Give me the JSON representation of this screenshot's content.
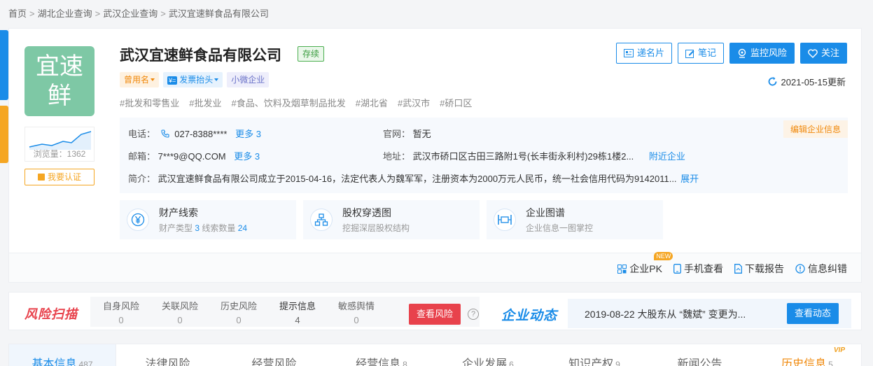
{
  "breadcrumb": [
    "首页",
    "湖北企业查询",
    "武汉企业查询",
    "武汉宜速鲜食品有限公司"
  ],
  "logo": {
    "line1": "宜速",
    "line2": "鲜",
    "bg_color": "#7ec8a5"
  },
  "views": {
    "label": "浏览量：1362"
  },
  "certify_label": "我要认证",
  "company": {
    "name": "武汉宜速鲜食品有限公司",
    "status": "存续"
  },
  "tags": {
    "former_name": "曾用名",
    "invoice": "发票抬头",
    "invoice_icon": "¥=",
    "size": "小微企业"
  },
  "industries": [
    "#批发和零售业",
    "#批发业",
    "#食品、饮料及烟草制品批发",
    "#湖北省",
    "#武汉市",
    "#硚口区"
  ],
  "actions": {
    "card": "递名片",
    "note": "笔记",
    "monitor": "监控风险",
    "follow": "关注"
  },
  "updated": "2021-05-15更新",
  "info": {
    "edit_label": "编辑企业信息",
    "phone_label": "电话：",
    "phone_value": "027-8388****",
    "phone_more": "更多 3",
    "website_label": "官网：",
    "website_value": "暂无",
    "email_label": "邮箱：",
    "email_value": "7***9@QQ.COM",
    "email_more": "更多 3",
    "address_label": "地址：",
    "address_value": "武汉市硚口区古田三路附1号(长丰街永利村)29栋1楼2...",
    "address_link": "附近企业",
    "intro_label": "简介：",
    "intro_value": "武汉宜速鲜食品有限公司成立于2015-04-16，法定代表人为魏军军，注册资本为2000万元人民币，统一社会信用代码为9142011...",
    "intro_more": "展开"
  },
  "features": [
    {
      "title": "财产线索",
      "sub_a": "财产类型",
      "num_a": "3",
      "sub_b": "线索数量",
      "num_b": "24",
      "icon": "yen-icon"
    },
    {
      "title": "股权穿透图",
      "sub": "挖掘深层股权结构",
      "icon": "org-chart-icon"
    },
    {
      "title": "企业图谱",
      "sub": "企业信息一图掌控",
      "icon": "graph-icon"
    }
  ],
  "tools": {
    "pk": "企业PK",
    "pk_badge": "NEW",
    "mobile": "手机查看",
    "report": "下载报告",
    "correct": "信息纠错"
  },
  "risk": {
    "logo": "风险扫描",
    "items": [
      {
        "label": "自身风险",
        "count": "0"
      },
      {
        "label": "关联风险",
        "count": "0"
      },
      {
        "label": "历史风险",
        "count": "0"
      },
      {
        "label": "提示信息",
        "count": "4"
      },
      {
        "label": "敏感舆情",
        "count": "0"
      }
    ],
    "button": "查看风险",
    "help": "?"
  },
  "dynamic": {
    "logo": "企业动态",
    "text": "2019-08-22 大股东从 “魏斌” 变更为...",
    "button": "查看动态"
  },
  "tabs": [
    {
      "label": "基本信息",
      "count": "487"
    },
    {
      "label": "法律风险",
      "count": ""
    },
    {
      "label": "经营风险",
      "count": ""
    },
    {
      "label": "经营信息",
      "count": "8"
    },
    {
      "label": "企业发展",
      "count": "6"
    },
    {
      "label": "知识产权",
      "count": "9"
    },
    {
      "label": "新闻公告",
      "count": ""
    },
    {
      "label": "历史信息",
      "count": "5"
    }
  ],
  "vip_badge": "VIP",
  "colors": {
    "accent": "#1a8ce8",
    "danger": "#e8424c",
    "orange": "#f0880a",
    "status_green": "#3a9c3f"
  }
}
